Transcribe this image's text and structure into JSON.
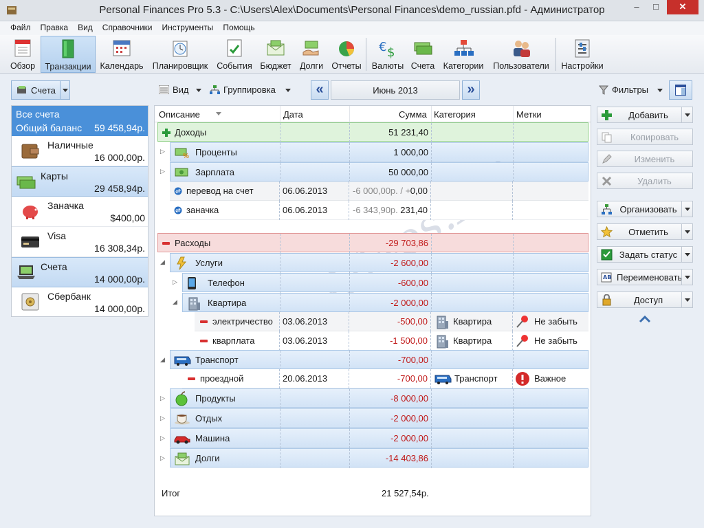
{
  "window": {
    "title": "Personal Finances Pro 5.3 - C:\\Users\\Alex\\Documents\\Personal Finances\\demo_russian.pfd - Администратор",
    "minimize": "–",
    "maximize": "□",
    "close": "✕"
  },
  "menu": [
    "Файл",
    "Правка",
    "Вид",
    "Справочники",
    "Инструменты",
    "Помощь"
  ],
  "toolbar": {
    "overview": "Обзор",
    "transactions": "Транзакции",
    "calendar": "Календарь",
    "planner": "Планировщик",
    "events": "События",
    "budget": "Бюджет",
    "debts": "Долги",
    "reports": "Отчеты",
    "currencies": "Валюты",
    "accounts": "Счета",
    "categories": "Категории",
    "users": "Пользователи",
    "settings": "Настройки"
  },
  "subtoolbar": {
    "accounts_combo": "Счета",
    "view": "Вид",
    "grouping": "Группировка",
    "period": "Июнь 2013",
    "prev": "«",
    "next": "»",
    "filters": "Фильтры"
  },
  "accounts": {
    "all_label": "Все счета",
    "total_label": "Общий баланс",
    "total_value": "59 458,94р.",
    "items": [
      {
        "name": "Наличные",
        "value": "16 000,00р."
      },
      {
        "name": "Карты",
        "value": "29 458,94р."
      },
      {
        "name": "Заначка",
        "value": "$400,00"
      },
      {
        "name": "Visa",
        "value": "16 308,34р."
      },
      {
        "name": "Счета",
        "value": "14 000,00р."
      },
      {
        "name": "Сбербанк",
        "value": "14 000,00р."
      }
    ]
  },
  "grid": {
    "columns": {
      "description": "Описание",
      "date": "Дата",
      "amount": "Сумма",
      "category": "Категория",
      "tags": "Метки"
    },
    "income": {
      "label": "Доходы",
      "amount": "51 231,40"
    },
    "income_rows": [
      {
        "label": "Проценты",
        "amount": "1 000,00"
      },
      {
        "label": "Зарплата",
        "amount": "50 000,00"
      }
    ],
    "transfers": [
      {
        "label": "перевод на счет",
        "date": "06.06.2013",
        "sub": "-6 000,00р. / +",
        "amount": "0,00"
      },
      {
        "label": "заначка",
        "date": "06.06.2013",
        "sub": "-6 343,90р.",
        "amount": "231,40"
      }
    ],
    "expense": {
      "label": "Расходы",
      "amount": "-29 703,86"
    },
    "services": {
      "label": "Услуги",
      "amount": "-2 600,00"
    },
    "phone": {
      "label": "Телефон",
      "amount": "-600,00"
    },
    "apartment": {
      "label": "Квартира",
      "amount": "-2 000,00"
    },
    "apt_items": [
      {
        "label": "электричество",
        "date": "03.06.2013",
        "amount": "-500,00",
        "category": "Квартира",
        "tag": "Не забыть"
      },
      {
        "label": "кварплата",
        "date": "03.06.2013",
        "amount": "-1 500,00",
        "category": "Квартира",
        "tag": "Не забыть"
      }
    ],
    "transport": {
      "label": "Транспорт",
      "amount": "-700,00"
    },
    "transport_item": {
      "label": "проездной",
      "date": "20.06.2013",
      "amount": "-700,00",
      "category": "Транспорт",
      "tag": "Важное"
    },
    "others": [
      {
        "label": "Продукты",
        "amount": "-8 000,00"
      },
      {
        "label": "Отдых",
        "amount": "-2 000,00"
      },
      {
        "label": "Машина",
        "amount": "-2 000,00"
      },
      {
        "label": "Долги",
        "amount": "-14 403,86"
      }
    ],
    "total_label": "Итог",
    "total_value": "21 527,54р."
  },
  "actions": {
    "add": "Добавить",
    "copy": "Копировать",
    "edit": "Изменить",
    "delete": "Удалить",
    "organize": "Организовать",
    "mark": "Отметить",
    "status": "Задать статус",
    "rename": "Переименовать",
    "access": "Доступ"
  },
  "watermark": "All4os.RU"
}
